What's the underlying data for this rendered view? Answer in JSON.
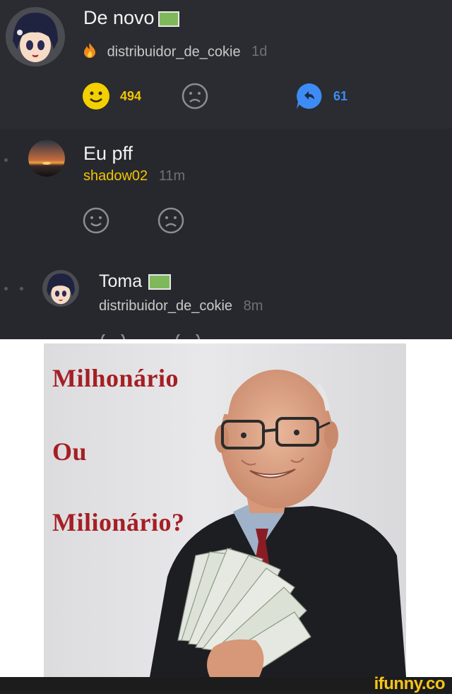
{
  "comments": [
    {
      "text": "De novo",
      "emoji_name": "dollar-banknote-icon",
      "author": "distribuidor_de_cokie",
      "time": "1d",
      "likes": "494",
      "replies": "61"
    },
    {
      "text": "Eu pff",
      "author": "shadow02",
      "time": "11m"
    },
    {
      "text": "Toma",
      "emoji_name": "dollar-banknote-icon",
      "author": "distribuidor_de_cokie",
      "time": "8m"
    }
  ],
  "meme": {
    "line1": "Milhonário",
    "line2": "Ou",
    "line3": "Milionário?"
  },
  "watermark": "ifunny.co",
  "colors": {
    "accent_yellow": "#f4c400",
    "reply_blue": "#3d8cf5",
    "meme_text_red": "#a51f24"
  }
}
